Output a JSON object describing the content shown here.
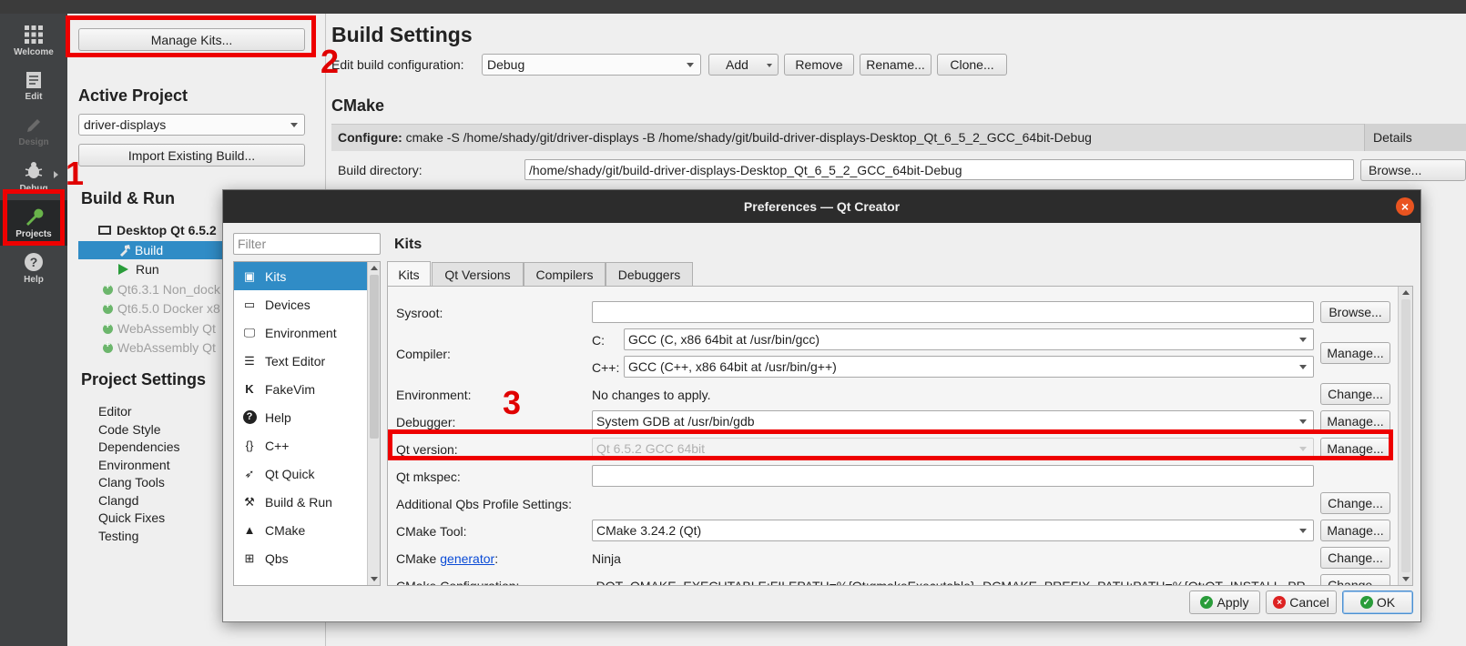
{
  "modebar": {
    "items": [
      {
        "label": "Welcome",
        "icon": "grid-icon"
      },
      {
        "label": "Edit",
        "icon": "document-icon"
      },
      {
        "label": "Design",
        "icon": "pencil-icon"
      },
      {
        "label": "Debug",
        "icon": "bug-icon"
      },
      {
        "label": "Projects",
        "icon": "wrench-icon"
      },
      {
        "label": "Help",
        "icon": "help-icon"
      }
    ]
  },
  "left": {
    "manage_kits": "Manage Kits...",
    "active_project_title": "Active Project",
    "project_select": "driver-displays",
    "import_build": "Import Existing Build...",
    "build_run_title": "Build & Run",
    "kit_name": "Desktop Qt 6.5.2",
    "build": "Build",
    "run": "Run",
    "other_kits": [
      "Qt6.3.1 Non_dock",
      "Qt6.5.0 Docker x8",
      "WebAssembly Qt",
      "WebAssembly Qt"
    ],
    "project_settings_title": "Project Settings",
    "project_settings": [
      "Editor",
      "Code Style",
      "Dependencies",
      "Environment",
      "Clang Tools",
      "Clangd",
      "Quick Fixes",
      "Testing"
    ]
  },
  "right": {
    "title": "Build Settings",
    "edit_config_label": "Edit build configuration:",
    "config_value": "Debug",
    "add": "Add",
    "remove": "Remove",
    "rename": "Rename...",
    "clone": "Clone...",
    "cmake_title": "CMake",
    "configure_label": "Configure:",
    "configure_cmd": "cmake -S /home/shady/git/driver-displays -B /home/shady/git/build-driver-displays-Desktop_Qt_6_5_2_GCC_64bit-Debug",
    "details": "Details",
    "build_dir_label": "Build directory:",
    "build_dir": "/home/shady/git/build-driver-displays-Desktop_Qt_6_5_2_GCC_64bit-Debug",
    "browse": "Browse..."
  },
  "annotations": {
    "one": "1",
    "two": "2",
    "three": "3",
    "color": "#ee0000"
  },
  "dialog": {
    "title": "Preferences — Qt Creator",
    "filter_placeholder": "Filter",
    "categories": [
      {
        "label": "Kits",
        "icon": "kits-icon"
      },
      {
        "label": "Devices",
        "icon": "devices-icon"
      },
      {
        "label": "Environment",
        "icon": "monitor-icon"
      },
      {
        "label": "Text Editor",
        "icon": "text-editor-icon"
      },
      {
        "label": "FakeVim",
        "icon": "fakevim-icon"
      },
      {
        "label": "Help",
        "icon": "help-icon"
      },
      {
        "label": "C++",
        "icon": "braces-icon"
      },
      {
        "label": "Qt Quick",
        "icon": "qt-quick-icon"
      },
      {
        "label": "Build & Run",
        "icon": "hammer-icon"
      },
      {
        "label": "CMake",
        "icon": "cmake-icon"
      },
      {
        "label": "Qbs",
        "icon": "qbs-icon"
      }
    ],
    "section_title": "Kits",
    "tabs": [
      "Kits",
      "Qt Versions",
      "Compilers",
      "Debuggers"
    ],
    "rows": {
      "sysroot_label": "Sysroot:",
      "sysroot_value": "",
      "compiler_label": "Compiler:",
      "c_label": "C:",
      "c_value": "GCC (C, x86 64bit at /usr/bin/gcc)",
      "cpp_label": "C++:",
      "cpp_value": "GCC (C++, x86 64bit at /usr/bin/g++)",
      "environment_label": "Environment:",
      "environment_value": "No changes to apply.",
      "debugger_label": "Debugger:",
      "debugger_value": "System GDB at /usr/bin/gdb",
      "qt_version_label": "Qt version:",
      "qt_version_value": "Qt 6.5.2 GCC 64bit",
      "qt_mkspec_label": "Qt mkspec:",
      "qt_mkspec_value": "",
      "qbs_label": "Additional Qbs Profile Settings:",
      "cmake_tool_label": "CMake Tool:",
      "cmake_tool_value": "CMake 3.24.2 (Qt)",
      "cmake_gen_prefix": "CMake",
      "cmake_gen_link": "generator",
      "cmake_gen_suffix": ":",
      "cmake_gen_value": "Ninja",
      "cmake_config_label": "CMake Configuration:",
      "cmake_config_value": "-DQT_QMAKE_EXECUTABLE:FILEPATH=%{Qt:qmakeExecutable} -DCMAKE_PREFIX_PATH:PATH=%{Qt:QT_INSTALL_PR"
    },
    "buttons": {
      "browse": "Browse...",
      "manage": "Manage...",
      "change": "Change...",
      "apply": "Apply",
      "cancel": "Cancel",
      "ok": "OK"
    }
  }
}
